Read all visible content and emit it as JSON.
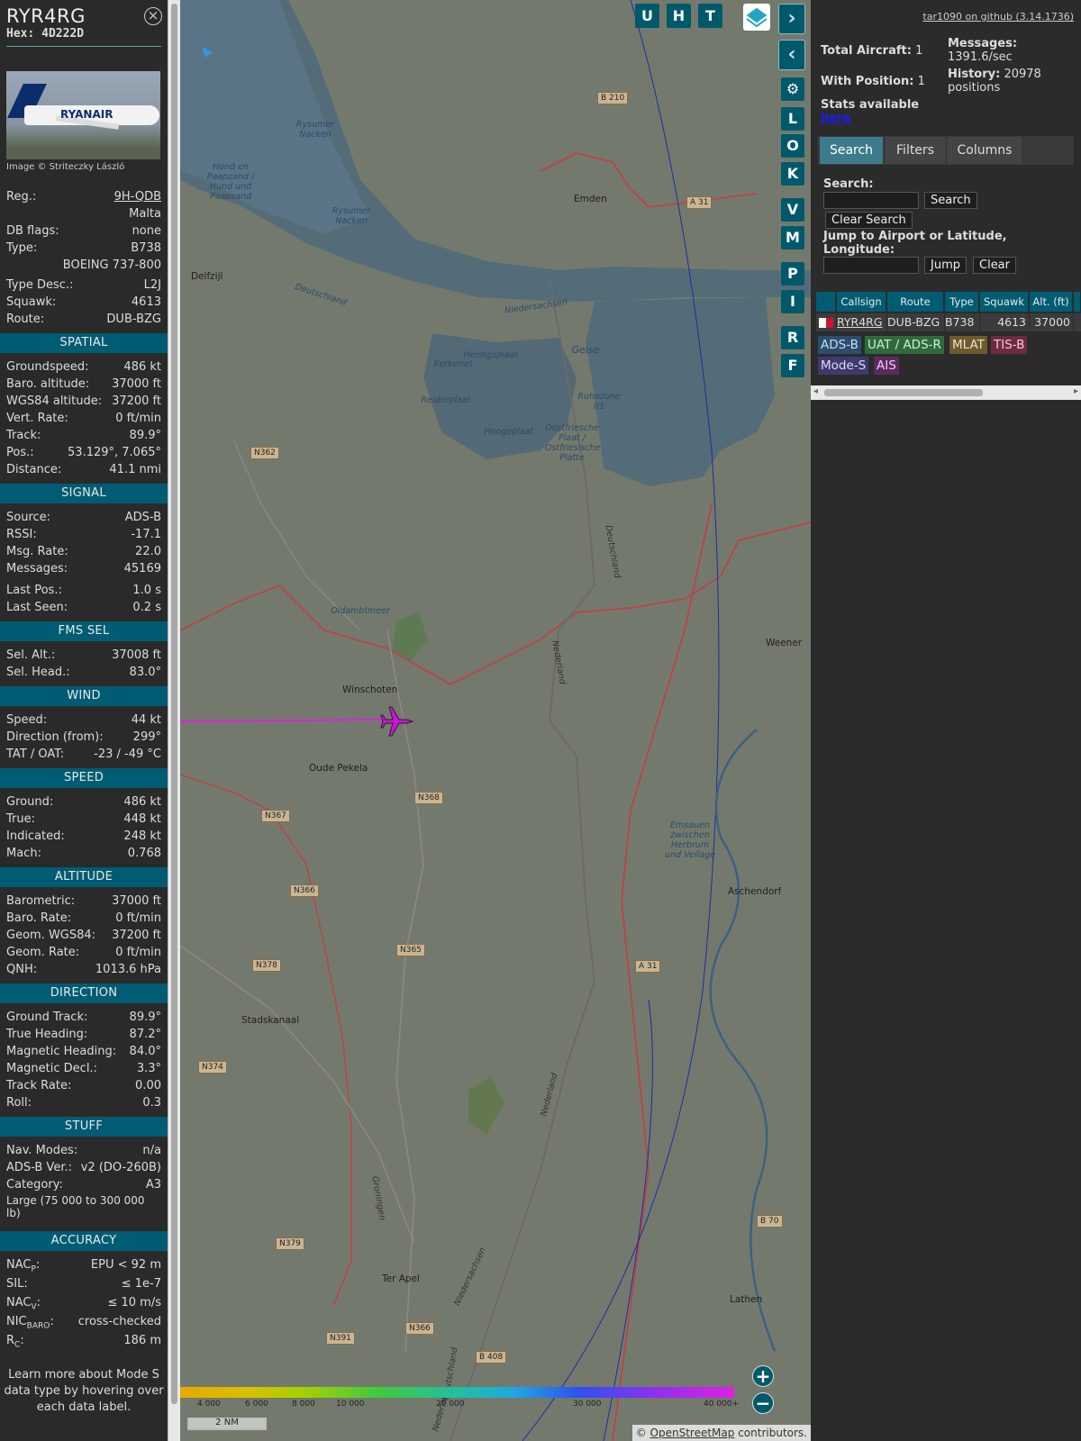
{
  "sidebar": {
    "callsign": "RYR4RG",
    "hex_label": "Hex:",
    "hex": "4D222D",
    "close_icon": "close-icon",
    "photo_credit": "Image © Striteczky László",
    "photo_livery_text": "RYANAIR",
    "info": {
      "reg_label": "Reg.:",
      "reg": "9H-QDB",
      "country": "Malta",
      "dbflags_label": "DB flags:",
      "dbflags": "none",
      "type_label": "Type:",
      "type": "B738",
      "type_full": "BOEING 737-800",
      "typedesc_label": "Type Desc.:",
      "typedesc": "L2J",
      "squawk_label": "Squawk:",
      "squawk": "4613",
      "route_label": "Route:",
      "route": "DUB-BZG"
    },
    "spatial": {
      "title": "SPATIAL",
      "rows": [
        {
          "label": "Groundspeed:",
          "value": "486 kt"
        },
        {
          "label": "Baro. altitude:",
          "value": "37000 ft"
        },
        {
          "label": "WGS84 altitude:",
          "value": "37200 ft"
        },
        {
          "label": "Vert. Rate:",
          "value": "0 ft/min"
        },
        {
          "label": "Track:",
          "value": "89.9°"
        },
        {
          "label": "Pos.:",
          "value": "53.129°, 7.065°"
        },
        {
          "label": "Distance:",
          "value": "41.1 nmi"
        }
      ]
    },
    "signal": {
      "title": "SIGNAL",
      "rows": [
        {
          "label": "Source:",
          "value": "ADS-B"
        },
        {
          "label": "RSSI:",
          "value": "-17.1"
        },
        {
          "label": "Msg. Rate:",
          "value": "22.0"
        },
        {
          "label": "Messages:",
          "value": "45169"
        },
        {
          "label": "Last Pos.:",
          "value": "1.0 s"
        },
        {
          "label": "Last Seen:",
          "value": "0.2 s"
        }
      ]
    },
    "fms": {
      "title": "FMS SEL",
      "rows": [
        {
          "label": "Sel. Alt.:",
          "value": "37008 ft"
        },
        {
          "label": "Sel. Head.:",
          "value": "83.0°"
        }
      ]
    },
    "wind": {
      "title": "WIND",
      "rows": [
        {
          "label": "Speed:",
          "value": "44 kt"
        },
        {
          "label": "Direction (from):",
          "value": "299°"
        },
        {
          "label": "TAT / OAT:",
          "value": "-23 / -49 °C"
        }
      ]
    },
    "speed": {
      "title": "SPEED",
      "rows": [
        {
          "label": "Ground:",
          "value": "486 kt"
        },
        {
          "label": "True:",
          "value": "448 kt"
        },
        {
          "label": "Indicated:",
          "value": "248 kt"
        },
        {
          "label": "Mach:",
          "value": "0.768"
        }
      ]
    },
    "altitude": {
      "title": "ALTITUDE",
      "rows": [
        {
          "label": "Barometric:",
          "value": "37000 ft"
        },
        {
          "label": "Baro. Rate:",
          "value": "0 ft/min"
        },
        {
          "label": "Geom. WGS84:",
          "value": "37200 ft"
        },
        {
          "label": "Geom. Rate:",
          "value": "0 ft/min"
        },
        {
          "label": "QNH:",
          "value": "1013.6 hPa"
        }
      ]
    },
    "direction": {
      "title": "DIRECTION",
      "rows": [
        {
          "label": "Ground Track:",
          "value": "89.9°"
        },
        {
          "label": "True Heading:",
          "value": "87.2°"
        },
        {
          "label": "Magnetic Heading:",
          "value": "84.0°"
        },
        {
          "label": "Magnetic Decl.:",
          "value": "3.3°"
        },
        {
          "label": "Track Rate:",
          "value": "0.00"
        },
        {
          "label": "Roll:",
          "value": "0.3"
        }
      ]
    },
    "stuff": {
      "title": "STUFF",
      "rows": [
        {
          "label": "Nav. Modes:",
          "value": "n/a"
        },
        {
          "label": "ADS-B Ver.:",
          "value": "v2 (DO-260B)"
        },
        {
          "label": "Category:",
          "value": "A3"
        }
      ],
      "category_desc": "Large (75 000 to 300 000 lb)"
    },
    "accuracy": {
      "title": "ACCURACY",
      "nacp_main": "NAC",
      "nacp_sub": "P",
      "nacp_value": "EPU < 92 m",
      "sil_label": "SIL:",
      "sil_value": "≤ 1e-7",
      "nacv_main": "NAC",
      "nacv_sub": "V",
      "nacv_value": "≤ 10 m/s",
      "nicbaro_main": "NIC",
      "nicbaro_sub": "BARO",
      "nicbaro_value": "cross-checked",
      "rc_main": "R",
      "rc_sub": "C",
      "rc_value": "186 m"
    },
    "learn_more": "Learn more about Mode S data type by hovering over each data label."
  },
  "map": {
    "top_buttons": [
      "U",
      "H",
      "T"
    ],
    "side_buttons": [
      "L",
      "O",
      "K",
      "V",
      "M",
      "P",
      "I",
      "R",
      "F"
    ],
    "places": {
      "emden": "Emden",
      "delfzijl": "Delfzijl",
      "winschoten": "Winschoten",
      "oude_pekela": "Oude Pekela",
      "weener": "Weener",
      "aschendorf": "Aschendorf",
      "stadskanaal": "Stadskanaal",
      "ter_apel": "Ter Apel",
      "lathen": "Lathen"
    },
    "water": {
      "rysumer_nacken_1": "Rysumer Nacken",
      "rysumer_nacken_2": "Rysumer Nacken",
      "hond_en_paapzand": "Hond en Paapzand / Hund und Paapsand",
      "deutschland_1": "Deutschland",
      "niedersachsen_1": "Niedersachsen",
      "heringsplaat": "Heringsplaat",
      "kerkeriet": "Kerkeriet",
      "reiderplaat": "Reiderplaat",
      "geise": "Geise",
      "ruhezone": "Ruhezone I/1",
      "hoogeplaat": "Hoogeplaat",
      "oostfriesche_plaat": "Oostfriesche Plaat / Ostfriesische Platte",
      "oldambtmeer": "Oldambtmeer",
      "emsauen": "Emsauen zwischen Herbrum und Vellage"
    },
    "borders": {
      "deutschland_2": "Deutschland",
      "nederland_1": "Nederland",
      "nederland_2": "Nederland",
      "nederland_3": "Nederland",
      "niedersachsen_2": "Niedersachsen",
      "deutschland_3": "Deutschland",
      "groningen": "Groningen"
    },
    "roads": {
      "b210": "B 210",
      "a31_1": "A 31",
      "n362": "N362",
      "n367": "N367",
      "n368": "N368",
      "n366_1": "N366",
      "n365": "N365",
      "n378": "N378",
      "a31_2": "A 31",
      "n374": "N374",
      "b70": "B 70",
      "n379": "N379",
      "n366_2": "N366",
      "n391": "N391",
      "b408": "B 408"
    },
    "altitude_scale": [
      "4 000",
      "6 000",
      "8 000",
      "10 000",
      "20 000",
      "30 000",
      "40 000+"
    ],
    "scale_label": "2 NM",
    "attribution_prefix": "©",
    "attribution_link": "OpenStreetMap",
    "attribution_suffix": " contributors.",
    "colors": {
      "track": "#e020e0",
      "aircraft": "#d010e0",
      "accent": "#00596b"
    }
  },
  "right": {
    "github": "tar1090 on github (3.14.1736)",
    "total_label": "Total Aircraft:",
    "total": "1",
    "withpos_label": "With Position:",
    "withpos": "1",
    "messages_label": "Messages:",
    "messages": "1391.6/sec",
    "history_label": "History:",
    "history": "20978 positions",
    "stats_label": "Stats available",
    "stats_link": "here",
    "tabs": [
      "Search",
      "Filters",
      "Columns"
    ],
    "search_label": "Search:",
    "search_button": "Search",
    "clear_search_button": "Clear Search",
    "jump_label": "Jump to Airport or Latitude, Longitude:",
    "jump_button": "Jump",
    "clear_button": "Clear",
    "table": {
      "headers": [
        "Callsign",
        "Route",
        "Type",
        "Squawk",
        "Alt. (ft)"
      ],
      "row": {
        "callsign": "RYR4RG",
        "route": "DUB-BZG",
        "type": "B738",
        "squawk": "4613",
        "alt": "37000"
      }
    },
    "badges": [
      {
        "label": "ADS-B",
        "bg": "#2b4e6e",
        "fg": "#cde"
      },
      {
        "label": "UAT / ADS-R",
        "bg": "#2f6a3f",
        "fg": "#cec"
      },
      {
        "label": "MLAT",
        "bg": "#6e5a2b",
        "fg": "#edc"
      },
      {
        "label": "TIS-B",
        "bg": "#6e2b3e",
        "fg": "#ecd"
      },
      {
        "label": "Mode-S",
        "bg": "#3e3a6e",
        "fg": "#dde"
      },
      {
        "label": "AIS",
        "bg": "#5a2b5e",
        "fg": "#ecf"
      }
    ]
  }
}
